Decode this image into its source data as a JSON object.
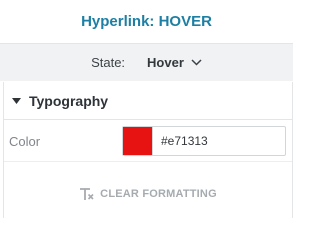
{
  "header": {
    "title": "Hyperlink: HOVER"
  },
  "state": {
    "label": "State:",
    "value": "Hover"
  },
  "typography": {
    "section_label": "Typography",
    "color": {
      "label": "Color",
      "value": "#e71313",
      "swatch": "#e71313"
    }
  },
  "actions": {
    "clear_formatting": "CLEAR FORMATTING"
  },
  "icons": {
    "state_dropdown": "chevron-down-icon",
    "section_toggle": "caret-down-icon",
    "clear": "clear-formatting-icon"
  },
  "colors": {
    "title": "#1d7fa3",
    "muted": "#a6abb0"
  }
}
